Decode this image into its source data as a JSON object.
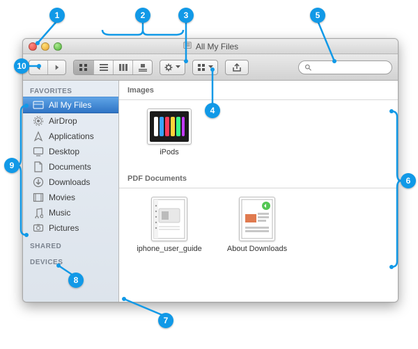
{
  "window": {
    "title": "All My Files"
  },
  "toolbar": {
    "search_placeholder": ""
  },
  "sidebar": {
    "sections": [
      {
        "header": "FAVORITES",
        "items": [
          {
            "label": "All My Files",
            "icon": "all-files-icon",
            "selected": true
          },
          {
            "label": "AirDrop",
            "icon": "airdrop-icon"
          },
          {
            "label": "Applications",
            "icon": "applications-icon"
          },
          {
            "label": "Desktop",
            "icon": "desktop-icon"
          },
          {
            "label": "Documents",
            "icon": "documents-icon"
          },
          {
            "label": "Downloads",
            "icon": "downloads-icon"
          },
          {
            "label": "Movies",
            "icon": "movies-icon"
          },
          {
            "label": "Music",
            "icon": "music-icon"
          },
          {
            "label": "Pictures",
            "icon": "pictures-icon"
          }
        ]
      },
      {
        "header": "SHARED",
        "items": []
      },
      {
        "header": "DEVICES",
        "items": []
      }
    ]
  },
  "content": {
    "groups": [
      {
        "header": "Images",
        "files": [
          {
            "name": "iPods",
            "kind": "image"
          }
        ]
      },
      {
        "header": "PDF Documents",
        "files": [
          {
            "name": "iphone_user_guide",
            "kind": "pdf"
          },
          {
            "name": "About Downloads",
            "kind": "pdf"
          }
        ]
      }
    ]
  },
  "callouts": {
    "1": "1",
    "2": "2",
    "3": "3",
    "4": "4",
    "5": "5",
    "6": "6",
    "7": "7",
    "8": "8",
    "9": "9",
    "10": "10"
  }
}
